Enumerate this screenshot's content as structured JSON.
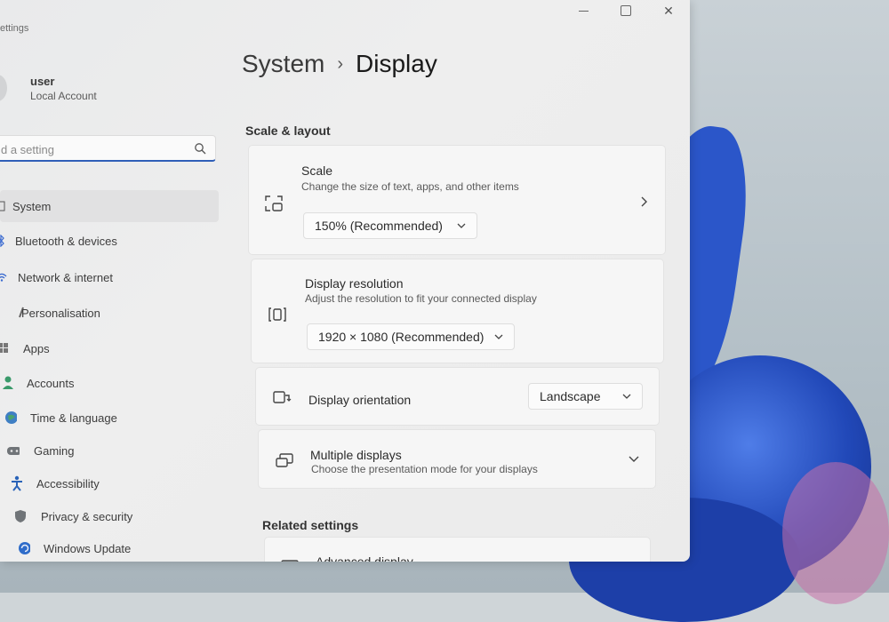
{
  "app": {
    "title": "ettings"
  },
  "window_controls": {
    "minimize": "",
    "maximize": "",
    "close": "✕"
  },
  "user": {
    "name": "user",
    "account_type": "Local Account"
  },
  "search": {
    "placeholder": "d a setting"
  },
  "sidebar": {
    "items": [
      {
        "label": "System",
        "icon": "system-icon",
        "active": true
      },
      {
        "label": "Bluetooth & devices",
        "icon": "bluetooth-icon"
      },
      {
        "label": "Network & internet",
        "icon": "network-icon"
      },
      {
        "label": "Personalisation",
        "icon": "brush-icon"
      },
      {
        "label": "Apps",
        "icon": "apps-icon"
      },
      {
        "label": "Accounts",
        "icon": "accounts-icon"
      },
      {
        "label": "Time & language",
        "icon": "globe-icon"
      },
      {
        "label": "Gaming",
        "icon": "gamepad-icon"
      },
      {
        "label": "Accessibility",
        "icon": "accessibility-icon"
      },
      {
        "label": "Privacy & security",
        "icon": "shield-icon"
      },
      {
        "label": "Windows Update",
        "icon": "update-icon"
      }
    ]
  },
  "breadcrumb": {
    "parent": "System",
    "separator": "›",
    "current": "Display"
  },
  "sections": {
    "scale_layout": "Scale & layout",
    "related": "Related settings"
  },
  "cards": {
    "scale": {
      "title": "Scale",
      "subtitle": "Change the size of text, apps, and other items",
      "value": "150% (Recommended)"
    },
    "resolution": {
      "title": "Display resolution",
      "subtitle": "Adjust the resolution to fit your connected display",
      "value": "1920 × 1080 (Recommended)"
    },
    "orientation": {
      "title": "Display orientation",
      "value": "Landscape"
    },
    "multiple": {
      "title": "Multiple displays",
      "subtitle": "Choose the presentation mode for your displays"
    },
    "advanced": {
      "title": "Advanced display"
    }
  },
  "colors": {
    "accent": "#2f5fb8",
    "wallpaper_blue": "#2148b8"
  }
}
